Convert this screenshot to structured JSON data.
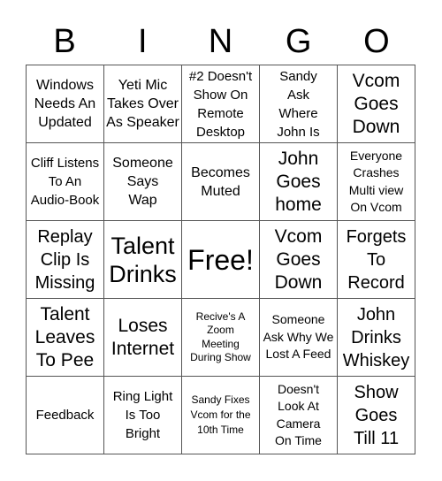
{
  "header": {
    "letters": [
      "B",
      "I",
      "N",
      "G",
      "O"
    ]
  },
  "cells": [
    [
      "Windows Needs An Updated",
      "Yeti Mic Takes Over As Speaker",
      "#2 Doesn't Show On Remote Desktop",
      "Sandy Ask Where John Is",
      "Vcom Goes Down"
    ],
    [
      "Cliff Listens To An Audio-Book",
      "Someone Says Wap",
      "Becomes Muted",
      "John Goes home",
      "Everyone Crashes Multi view On Vcom"
    ],
    [
      "Replay Clip Is Missing",
      "Talent Drinks",
      "Free!",
      "Vcom Goes Down",
      "Forgets To Record"
    ],
    [
      "Talent Leaves To Pee",
      "Loses Internet",
      "Recive's A Zoom Meeting During Show",
      "Someone Ask Why We Lost A Feed",
      "John Drinks Whiskey"
    ],
    [
      "Feedback",
      "Ring Light Is Too Bright",
      "Sandy Fixes Vcom for the 10th Time",
      "Doesn't Look At Camera On Time",
      "Show Goes Till 11"
    ]
  ]
}
